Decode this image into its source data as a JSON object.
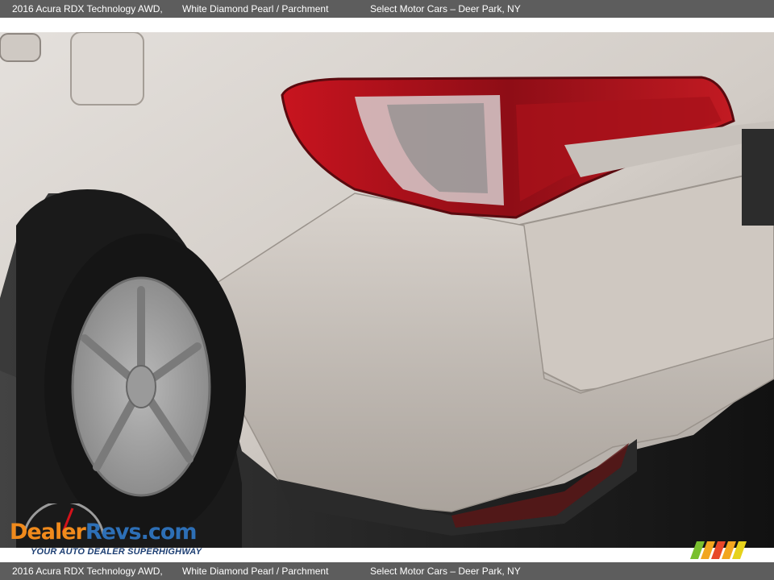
{
  "caption": {
    "model": "2016 Acura RDX Technology AWD,",
    "color": "White Diamond Pearl / Parchment",
    "dealer": "Select Motor Cars – Deer Park, NY"
  },
  "watermark": {
    "brand_left": "Dealer",
    "brand_right": "Revs.com",
    "tagline": "YOUR AUTO DEALER SUPERHIGHWAY",
    "gauge_digits": "4 5 6"
  },
  "colors": {
    "bar": "#5d5d5d",
    "paint": "#d8d2cc",
    "taillight": "#b5121b",
    "floor": "#1b1b1b",
    "brand_orange": "#f08a1c",
    "brand_blue": "#2d6fb6"
  }
}
